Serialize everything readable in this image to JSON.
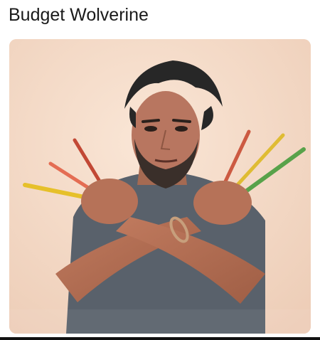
{
  "post": {
    "title": "Budget Wolverine"
  },
  "colors": {
    "background": "#ffffff",
    "wall": "#f3dac7",
    "shirt": "#58606a",
    "skin": "#b27057",
    "hair": "#262626"
  }
}
